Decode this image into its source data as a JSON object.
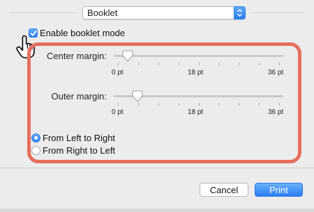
{
  "layout_select": {
    "value": "Booklet",
    "icon": "up-down-chevron-icon"
  },
  "booklet_mode": {
    "label": "Enable booklet mode",
    "checked": true
  },
  "center_margin": {
    "label": "Center margin:",
    "value_pt": 3,
    "min_label": "0 pt",
    "mid_label": "18 pt",
    "max_label": "36 pt"
  },
  "outer_margin": {
    "label": "Outer margin:",
    "value_pt": 5,
    "min_label": "0 pt",
    "mid_label": "18 pt",
    "max_label": "36 pt"
  },
  "direction": {
    "options": [
      {
        "label": "From Left to Right",
        "selected": true
      },
      {
        "label": "From Right to Left",
        "selected": false
      }
    ]
  },
  "buttons": {
    "cancel": "Cancel",
    "print": "Print"
  },
  "colors": {
    "accent": "#2b7ff2",
    "highlight": "#e66f5e"
  }
}
